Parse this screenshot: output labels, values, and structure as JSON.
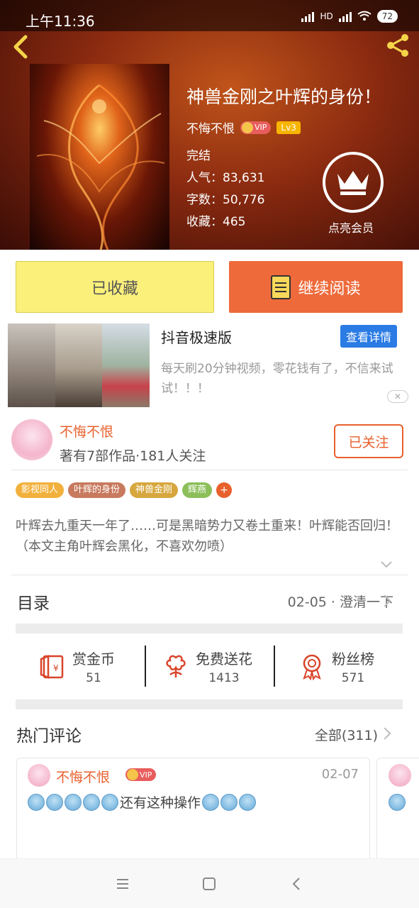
{
  "status_bar": {
    "time": "上午11:36",
    "network": "HD",
    "battery": "72"
  },
  "book": {
    "title": "神兽金刚之叶辉的身份！",
    "author": "不悔不恨",
    "vip_label": "VIP",
    "level": "Lv3",
    "status": "完结",
    "popularity": "人气：83,631",
    "word_count": "字数：50,776",
    "favorites": "收藏：465",
    "member_label": "点亮会员"
  },
  "actions": {
    "collected_label": "已收藏",
    "continue_label": "继续阅读"
  },
  "ad": {
    "title": "抖音极速版",
    "detail_label": "查看详情",
    "description": "每天刷20分钟视频，零花钱有了，不信来试试！！！",
    "close_label": "✕"
  },
  "author_section": {
    "name": "不悔不恨",
    "info": "著有7部作品·181人关注",
    "follow_label": "已关注"
  },
  "tags": [
    {
      "label": "影视同人",
      "color": "#f2b13c"
    },
    {
      "label": "叶辉的身份",
      "color": "#c87a5e"
    },
    {
      "label": "神兽金刚",
      "color": "#d7a73e"
    },
    {
      "label": "辉燕",
      "color": "#8cbf5a"
    }
  ],
  "tag_more": "+",
  "intro": "叶辉去九重天一年了……可是黑暗势力又卷土重来！叶辉能否回归！（本文主角叶辉会黑化，不喜欢勿喷）",
  "toc": {
    "title": "目录",
    "latest": "02-05 · 澄清一下"
  },
  "stats": {
    "reward_label": "赏金币",
    "reward_value": "51",
    "flower_label": "免费送花",
    "flower_value": "1413",
    "fans_label": "粉丝榜",
    "fans_value": "571"
  },
  "comments": {
    "title": "热门评论",
    "all_label": "全部(311)",
    "items": [
      {
        "author": "不悔不恨",
        "vip": "VIP",
        "date": "02-07",
        "text": "还有这种操作"
      }
    ]
  },
  "colors": {
    "accent": "#e8602c",
    "collected_bg": "#faf07a",
    "read_bg": "#ee6a3a",
    "detail_bg": "#2a7be4"
  },
  "icons": [
    "back-arrow-icon",
    "share-icon",
    "crown-icon",
    "book-icon",
    "red-envelope-icon",
    "flower-icon",
    "medal-icon",
    "menu-icon",
    "home-square-icon",
    "back-nav-icon"
  ]
}
